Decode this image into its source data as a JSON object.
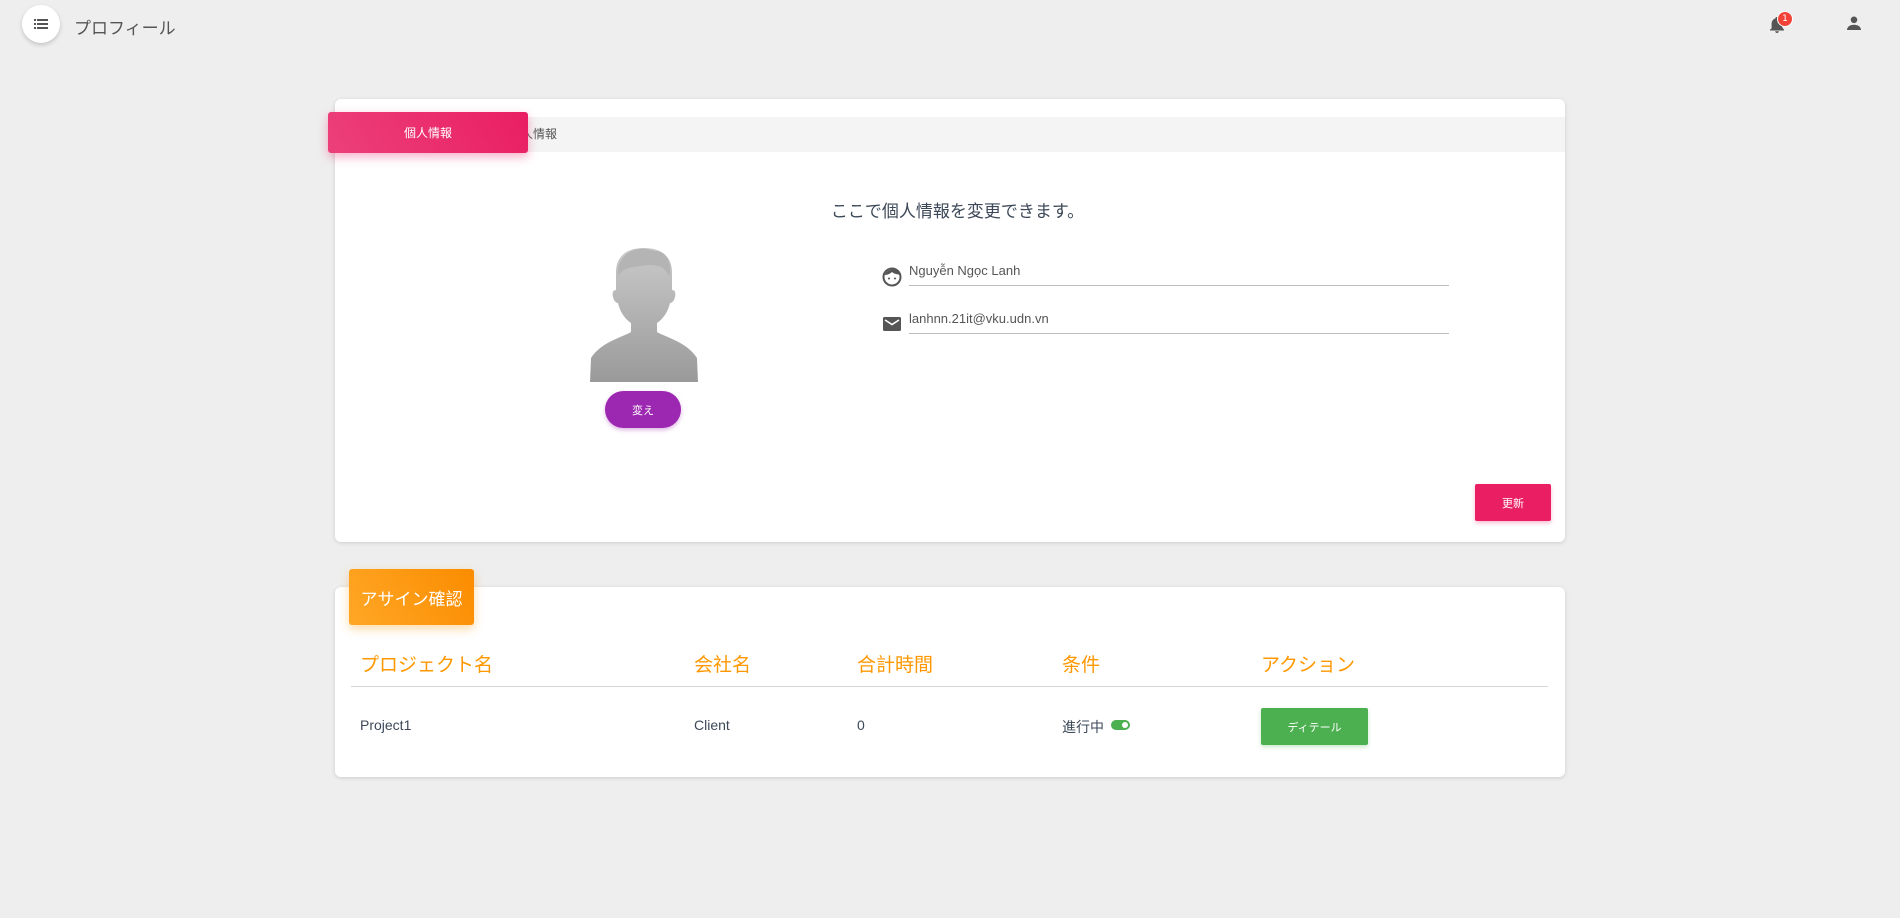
{
  "header": {
    "title": "プロフィール",
    "notification_count": "1",
    "icons": [
      "list-icon",
      "bell-icon",
      "person-icon"
    ]
  },
  "profile": {
    "tab_active_label": "個人情報",
    "tab_ghost_label": "人情報",
    "heading": "ここで個人情報を変更できます。",
    "change_button": "変え",
    "name_value": "Nguyễn Ngọc Lanh",
    "email_value": "lanhnn.21it@vku.udn.vn",
    "update_button": "更新"
  },
  "assignments": {
    "title": "アサイン確認",
    "columns": [
      "プロジェクト名",
      "会社名",
      "合計時間",
      "条件",
      "アクション"
    ],
    "rows": [
      {
        "project": "Project1",
        "company": "Client",
        "hours": "0",
        "status": "進行中",
        "action": "ディテール"
      }
    ]
  },
  "colors": {
    "primary_pink": "#e91e63",
    "purple": "#9c27b0",
    "orange": "#ff9800",
    "green": "#4caf50"
  }
}
